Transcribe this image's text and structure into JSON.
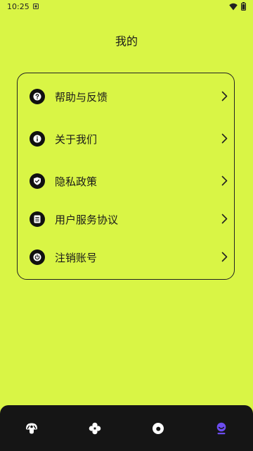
{
  "status_bar": {
    "time": "10:25"
  },
  "page": {
    "title": "我的"
  },
  "menu": {
    "items": [
      {
        "label": "帮助与反馈",
        "icon": "help-icon"
      },
      {
        "label": "关于我们",
        "icon": "info-icon"
      },
      {
        "label": "隐私政策",
        "icon": "shield-check-icon"
      },
      {
        "label": "用户服务协议",
        "icon": "document-icon"
      },
      {
        "label": "注销账号",
        "icon": "power-icon"
      }
    ]
  },
  "bottom_nav": {
    "tabs": [
      {
        "icon": "mushroom-icon",
        "active": false
      },
      {
        "icon": "four-circles-icon",
        "active": false
      },
      {
        "icon": "donut-icon",
        "active": false
      },
      {
        "icon": "profile-icon",
        "active": true
      }
    ],
    "active_color": "#6c4cf0",
    "inactive_color": "#ffffff"
  },
  "colors": {
    "background": "#d9f545",
    "nav_background": "#151515"
  }
}
